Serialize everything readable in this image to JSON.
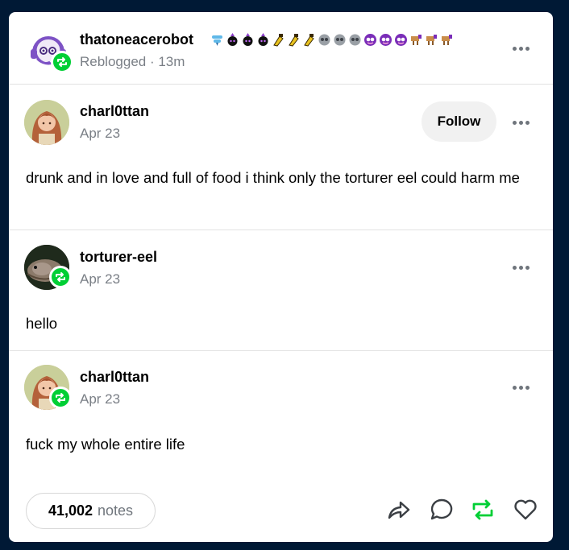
{
  "header": {
    "blog_name": "thatoneacerobot",
    "meta": "Reblogged · 13m",
    "badges": [
      "ice-cream-badge",
      "witch-hat-badge",
      "witch-hat-badge",
      "witch-hat-badge",
      "beer-badge",
      "beer-badge",
      "beer-badge",
      "robot-head-badge",
      "robot-head-badge",
      "robot-head-badge",
      "purple-face-badge",
      "purple-face-badge",
      "purple-face-badge",
      "camel-badge",
      "camel-badge",
      "camel-badge"
    ]
  },
  "posts": [
    {
      "author": "charl0ttan",
      "date": "Apr 23",
      "text": "drunk and in love and full of food i think only the torturer eel could harm me",
      "follow_label": "Follow"
    },
    {
      "author": "torturer-eel",
      "date": "Apr 23",
      "text": "hello"
    },
    {
      "author": "charl0ttan",
      "date": "Apr 23",
      "text": "fuck my whole entire life"
    }
  ],
  "footer": {
    "notes_count": "41,002",
    "notes_label": "notes",
    "colors": {
      "reblog": "#00cf35",
      "icon": "#3b3f44"
    }
  }
}
